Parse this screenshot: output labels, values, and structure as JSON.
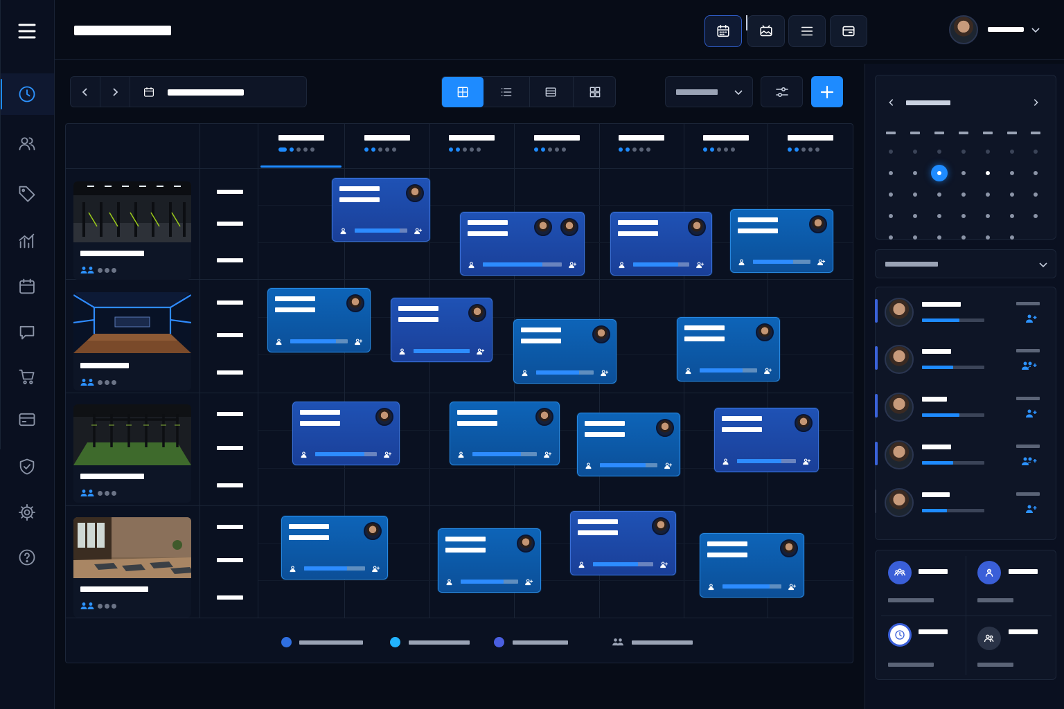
{
  "app": {
    "title": ""
  },
  "user": {
    "name": ""
  },
  "toolbar": {
    "date_range": "",
    "filter_value": ""
  },
  "legend": [
    {
      "label": "",
      "color": "#2f6fe0"
    },
    {
      "label": "",
      "color": "#22b4ff"
    },
    {
      "label": "",
      "color": "#4a5fe0"
    },
    {
      "label": "",
      "icon": "users-icon"
    }
  ],
  "colors": {
    "accent": "#1e8bff",
    "card_primary": "#1f52b5",
    "card_secondary": "#0d64b8",
    "background": "#070c17"
  },
  "icons": {
    "rail": [
      "clock-icon",
      "users-icon",
      "tag-icon",
      "analytics-icon",
      "calendar-icon",
      "chat-icon",
      "cart-icon",
      "card-icon",
      "shield-icon",
      "gear-icon",
      "help-icon"
    ],
    "top": [
      "calendar-icon",
      "image-icon",
      "list-icon",
      "window-icon"
    ],
    "views": [
      "grid-view-icon",
      "list-view-icon",
      "table-view-icon",
      "tiles-view-icon"
    ]
  },
  "schedule": {
    "days": [
      {
        "name": "",
        "progress_dots": 2
      },
      {
        "name": "",
        "progress_dots": 2
      },
      {
        "name": "",
        "progress_dots": 2
      },
      {
        "name": "",
        "progress_dots": 2
      },
      {
        "name": "",
        "progress_dots": 2
      },
      {
        "name": "",
        "progress_dots": 2
      },
      {
        "name": "",
        "progress_dots": 2
      }
    ],
    "selected_day_index": 0,
    "rooms": [
      {
        "name": "",
        "scene": "gym-equipment"
      },
      {
        "name": "",
        "scene": "studio-neon"
      },
      {
        "name": "",
        "scene": "functional-rig"
      },
      {
        "name": "",
        "scene": "yoga-room"
      }
    ],
    "sessions": [
      {
        "title": "",
        "subtitle": "",
        "instructors": 1,
        "capacity_filled": 0.85
      },
      {
        "title": "",
        "subtitle": "",
        "instructors": 2,
        "capacity_filled": 0.75
      },
      {
        "title": "",
        "subtitle": "",
        "instructors": 1,
        "capacity_filled": 0.8
      },
      {
        "title": "",
        "subtitle": "",
        "instructors": 1,
        "capacity_filled": 0.7
      },
      {
        "title": "",
        "subtitle": "",
        "instructors": 1,
        "capacity_filled": 0.8
      },
      {
        "title": "",
        "subtitle": "",
        "instructors": 1,
        "capacity_filled": 1.0
      },
      {
        "title": "",
        "subtitle": "",
        "instructors": 1,
        "capacity_filled": 0.75
      },
      {
        "title": "",
        "subtitle": "",
        "instructors": 1,
        "capacity_filled": 0.75
      },
      {
        "title": "",
        "subtitle": "",
        "instructors": 1,
        "capacity_filled": 0.8
      },
      {
        "title": "",
        "subtitle": "",
        "instructors": 1,
        "capacity_filled": 0.75
      },
      {
        "title": "",
        "subtitle": "",
        "instructors": 1,
        "capacity_filled": 0.8
      },
      {
        "title": "",
        "subtitle": "",
        "instructors": 1,
        "capacity_filled": 0.75
      },
      {
        "title": "",
        "subtitle": "",
        "instructors": 1,
        "capacity_filled": 0.7
      },
      {
        "title": "",
        "subtitle": "",
        "instructors": 1,
        "capacity_filled": 0.75
      },
      {
        "title": "",
        "subtitle": "",
        "instructors": 1,
        "capacity_filled": 0.75
      },
      {
        "title": "",
        "subtitle": "",
        "instructors": 1,
        "capacity_filled": 0.8
      },
      {
        "title": "",
        "subtitle": "",
        "instructors": 1,
        "capacity_filled": 0.75
      }
    ]
  },
  "mini_calendar": {
    "month": "",
    "selected_day": 10
  },
  "staff_filter": {
    "label": ""
  },
  "staff": [
    {
      "name": "",
      "role": "",
      "workload": 0.6
    },
    {
      "name": "",
      "role": "",
      "workload": 0.5
    },
    {
      "name": "",
      "role": "",
      "workload": 0.6
    },
    {
      "name": "",
      "role": "",
      "workload": 0.5
    },
    {
      "name": "",
      "role": "",
      "workload": 0.4
    }
  ],
  "stats": [
    {
      "value": "",
      "label": "",
      "icon": "group-icon",
      "color": "#3a5fd8"
    },
    {
      "value": "",
      "label": "",
      "icon": "member-icon",
      "color": "#3a5fd8"
    },
    {
      "value": "",
      "label": "",
      "icon": "clock-icon",
      "color": "#3a5fd8"
    },
    {
      "value": "",
      "label": "",
      "icon": "team-icon",
      "color": "#2a3347"
    }
  ]
}
